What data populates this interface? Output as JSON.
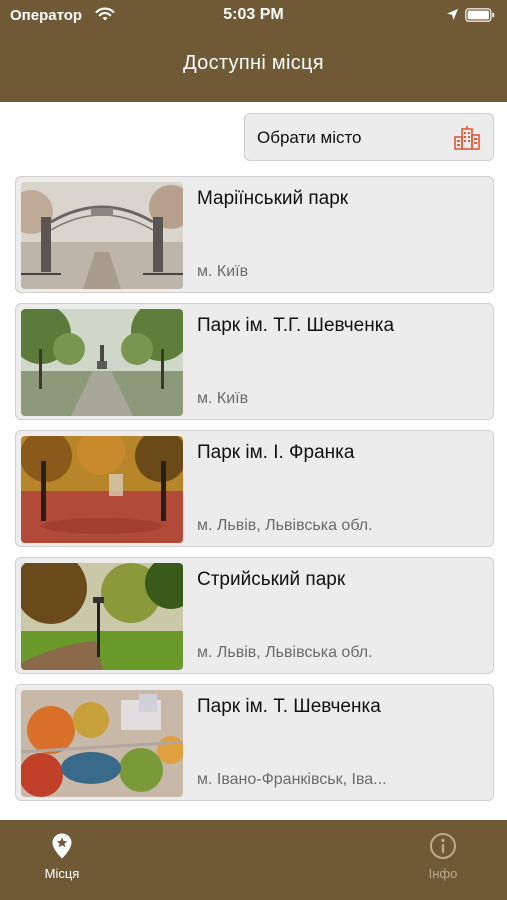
{
  "status_bar": {
    "carrier": "Оператор",
    "time": "5:03 PM"
  },
  "nav": {
    "title": "Доступні місця"
  },
  "city_button": {
    "label": "Обрати місто",
    "icon": "city-buildings-icon",
    "icon_color": "#e05a3a"
  },
  "places": [
    {
      "title": "Маріїнський парк",
      "subtitle": "м. Київ",
      "image": "foggy-park-gate"
    },
    {
      "title": "Парк ім. Т.Г. Шевченка",
      "subtitle": "м. Київ",
      "image": "park-alley-monument"
    },
    {
      "title": "Парк ім. І. Франка",
      "subtitle": "м. Львів, Львівська обл.",
      "image": "autumn-park-red-leaves"
    },
    {
      "title": "Стрийський парк",
      "subtitle": "м. Львів, Львівська обл.",
      "image": "autumn-park-lantern-path"
    },
    {
      "title": "Парк ім. Т. Шевченка",
      "subtitle": "м. Івано-Франківськ, Іва...",
      "image": "aerial-autumn-park-lake"
    }
  ],
  "tabs": [
    {
      "label": "Місця",
      "icon": "map-pin-star-icon",
      "active": true
    },
    {
      "label": "Інфо",
      "icon": "info-circle-icon",
      "active": false
    }
  ],
  "colors": {
    "brand": "#705a36",
    "card_bg": "#ececec",
    "inactive_tab": "#b9ab8f"
  }
}
